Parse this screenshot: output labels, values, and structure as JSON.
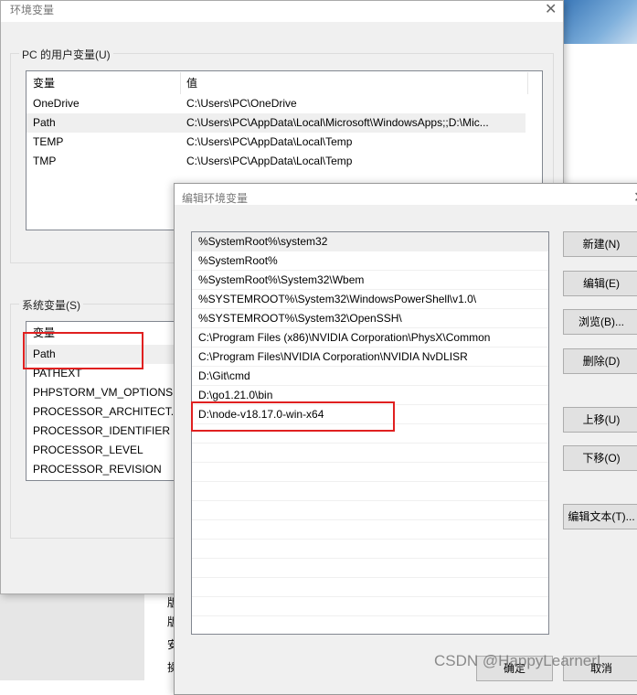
{
  "background": {
    "partial_chars": [
      "版",
      "版",
      "安",
      "操"
    ]
  },
  "env_dialog": {
    "title": "环境变量",
    "user_group_label": "PC 的用户变量(U)",
    "columns": [
      "变量",
      "值"
    ],
    "user_vars": [
      {
        "name": "OneDrive",
        "value": "C:\\Users\\PC\\OneDrive"
      },
      {
        "name": "Path",
        "value": "C:\\Users\\PC\\AppData\\Local\\Microsoft\\WindowsApps;;D:\\Mic..."
      },
      {
        "name": "TEMP",
        "value": "C:\\Users\\PC\\AppData\\Local\\Temp"
      },
      {
        "name": "TMP",
        "value": "C:\\Users\\PC\\AppData\\Local\\Temp"
      }
    ],
    "system_group_label": "系统变量(S)",
    "system_header": "变量",
    "system_vars": [
      "Path",
      "PATHEXT",
      "PHPSTORM_VM_OPTIONS",
      "PROCESSOR_ARCHITECT...",
      "PROCESSOR_IDENTIFIER",
      "PROCESSOR_LEVEL",
      "PROCESSOR_REVISION"
    ]
  },
  "edit_dialog": {
    "title": "编辑环境变量",
    "entries": [
      "%SystemRoot%\\system32",
      "%SystemRoot%",
      "%SystemRoot%\\System32\\Wbem",
      "%SYSTEMROOT%\\System32\\WindowsPowerShell\\v1.0\\",
      "%SYSTEMROOT%\\System32\\OpenSSH\\",
      "C:\\Program Files (x86)\\NVIDIA Corporation\\PhysX\\Common",
      "C:\\Program Files\\NVIDIA Corporation\\NVIDIA NvDLISR",
      "D:\\Git\\cmd",
      "D:\\go1.21.0\\bin",
      "D:\\node-v18.17.0-win-x64"
    ],
    "buttons": {
      "new": "新建(N)",
      "edit": "编辑(E)",
      "browse": "浏览(B)...",
      "delete": "删除(D)",
      "up": "上移(U)",
      "down": "下移(O)",
      "edit_text": "编辑文本(T)...",
      "ok": "确定",
      "cancel": "取消"
    }
  },
  "watermark": "CSDN @HappyLearnerL",
  "colors": {
    "highlight": "#e02020",
    "selection": "#efefef"
  }
}
